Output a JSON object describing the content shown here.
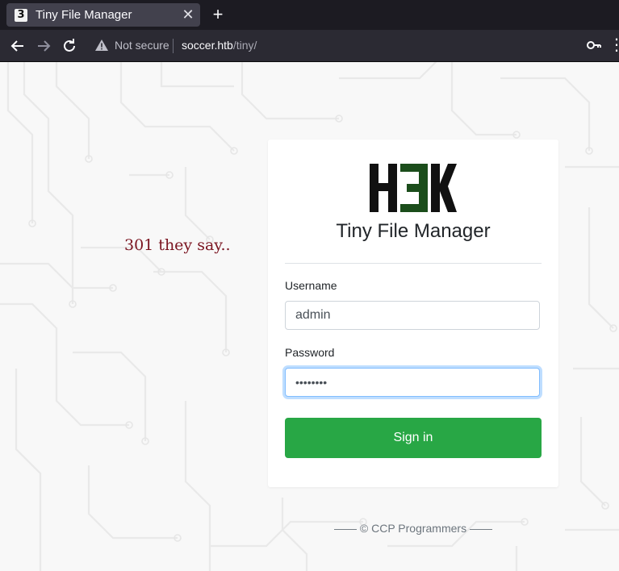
{
  "browser": {
    "tab": {
      "favicon": "3",
      "title": "Tiny File Manager",
      "close_icon": "close-icon"
    },
    "new_tab_icon": "plus-icon",
    "nav": {
      "back_icon": "arrow-left-icon",
      "forward_icon": "arrow-right-icon",
      "reload_icon": "reload-icon"
    },
    "security_label": "Not secure",
    "url": {
      "host": "soccer.htb",
      "path": "/tiny/"
    },
    "key_icon": "key-icon",
    "menu_icon": "more-icon"
  },
  "page": {
    "tagline": "301 they say..",
    "login": {
      "logo": "H3K",
      "title": "Tiny File Manager",
      "username_label": "Username",
      "username_value": "admin",
      "password_label": "Password",
      "password_mask": "••••••••",
      "submit_label": "Sign in"
    },
    "footer": "—— © CCP Programmers ——"
  },
  "colors": {
    "accent_green": "#28a745",
    "tagline_red": "#7a1420",
    "logo_green": "#1b4d1b",
    "chrome_dark": "#1c1b22",
    "focus_blue": "#80bdff"
  }
}
